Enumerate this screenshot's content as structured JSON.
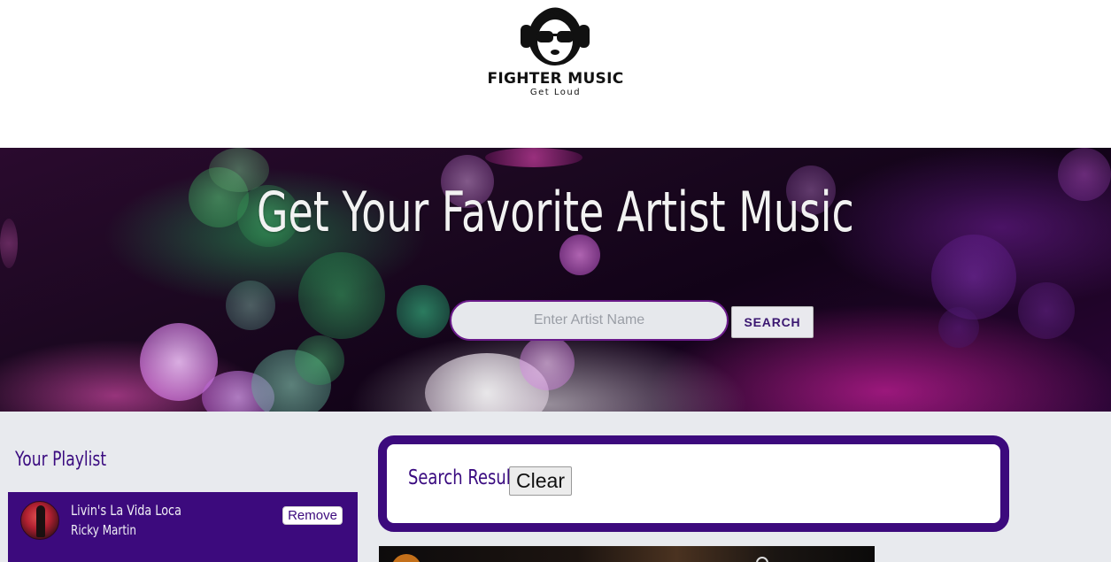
{
  "brand": {
    "name": "FIGHTER MUSIC",
    "tagline": "Get Loud",
    "logo_icon": "monkey-headphones-logo"
  },
  "hero": {
    "title": "Get Your Favorite Artist Music",
    "search": {
      "placeholder": "Enter Artist Name",
      "value": "",
      "button_label": "SEARCH"
    }
  },
  "playlist": {
    "heading": "Your Playlist",
    "items": [
      {
        "title": "Livin's La Vida Loca",
        "artist": "Ricky Martin",
        "remove_label": "Remove"
      }
    ]
  },
  "results": {
    "heading": "Search Results",
    "clear_label": "Clear"
  },
  "colors": {
    "accent_purple": "#3c0a7d",
    "page_bg": "#e8eaee"
  }
}
